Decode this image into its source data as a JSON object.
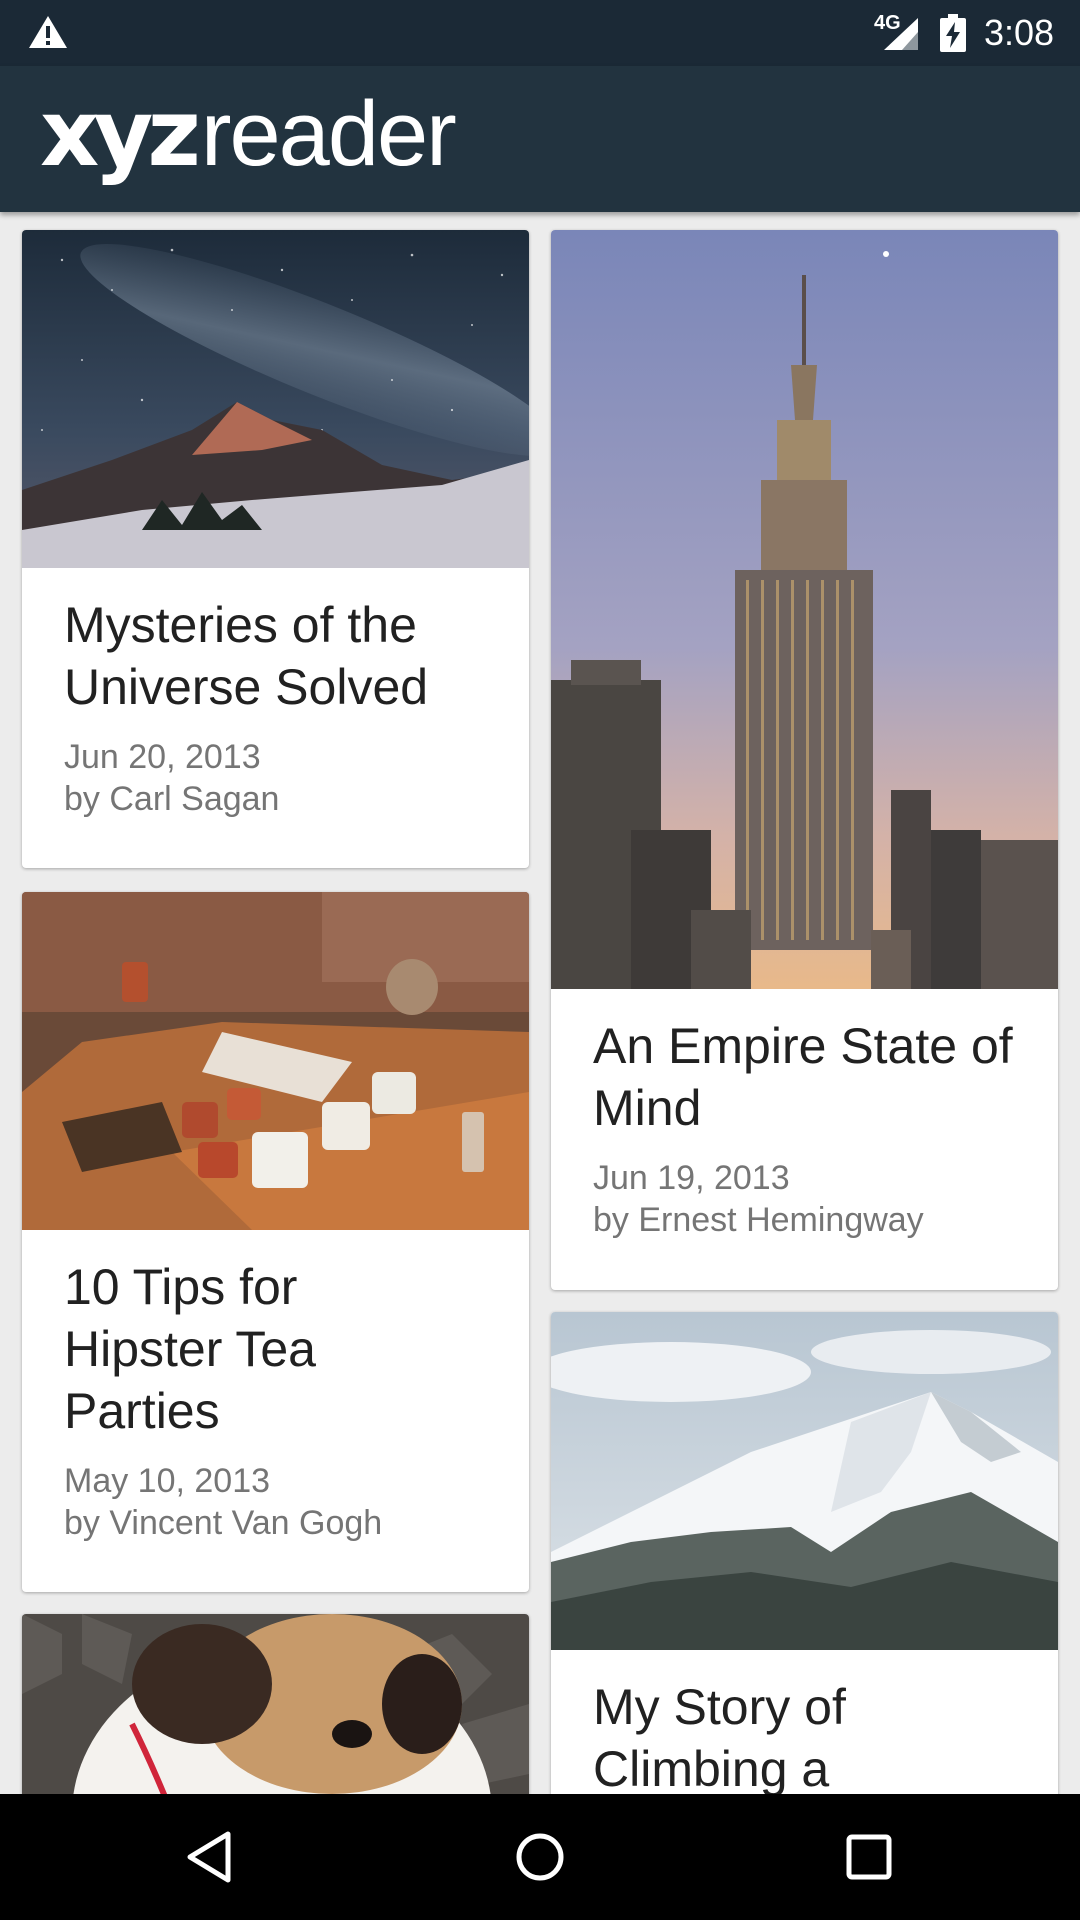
{
  "status_bar": {
    "network": "4G",
    "time": "3:08",
    "icons": [
      "warning-icon",
      "signal-icon",
      "battery-charging-icon"
    ]
  },
  "app_bar": {
    "logo_bold": "xyz",
    "logo_light": "reader",
    "background": "#22333f"
  },
  "articles": [
    {
      "title": "Mysteries of the Universe Solved",
      "date": "Jun 20, 2013",
      "author": "by Carl Sagan",
      "image": "night-sky-mountain"
    },
    {
      "title": "An Empire State of Mind",
      "date": "Jun 19, 2013",
      "author": "by Ernest Hemingway",
      "image": "empire-state-building"
    },
    {
      "title": "10 Tips for Hipster Tea Parties",
      "date": "May 10, 2013",
      "author": "by Vincent Van Gogh",
      "image": "tea-cups-table"
    },
    {
      "title": "My Story of Climbing a",
      "date": "",
      "author": "",
      "image": "snowy-mountain"
    },
    {
      "title": "",
      "date": "",
      "author": "",
      "image": "bulldog"
    }
  ],
  "nav_bar": {
    "icons": [
      "back-icon",
      "home-icon",
      "recents-icon"
    ]
  }
}
